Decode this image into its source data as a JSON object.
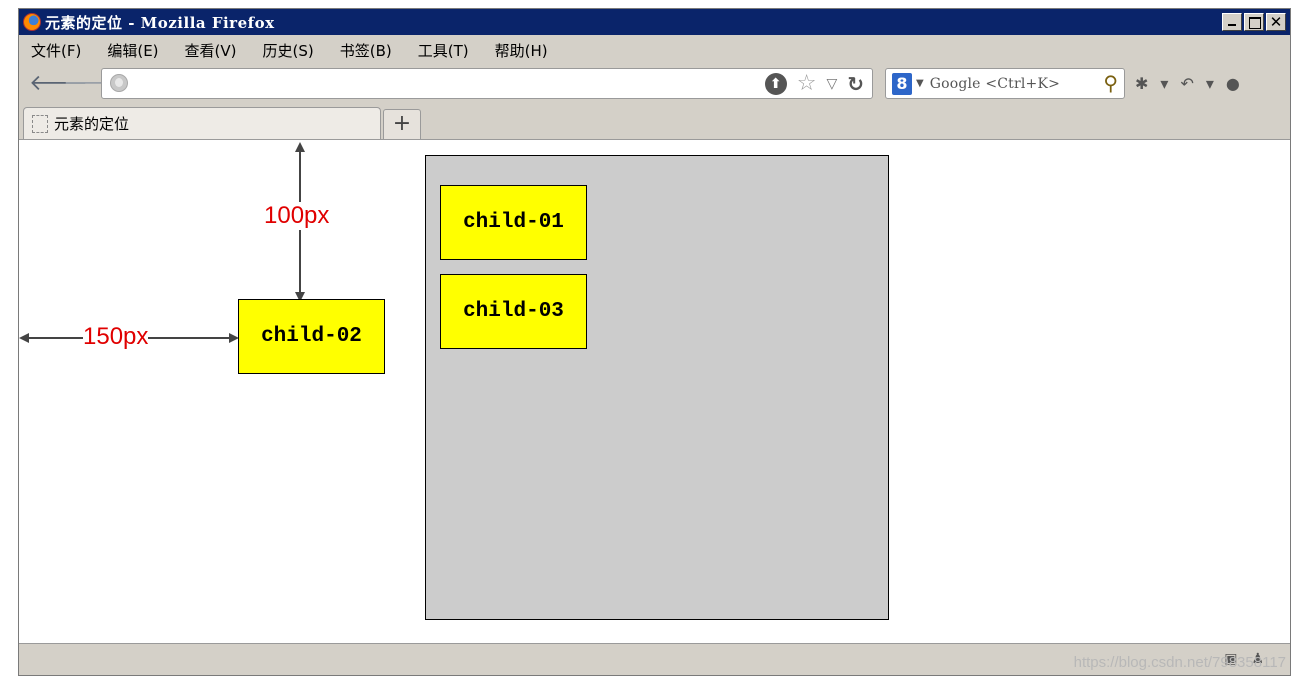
{
  "window": {
    "title": "元素的定位 - Mozilla Firefox"
  },
  "menu": {
    "items": [
      "文件(F)",
      "编辑(E)",
      "查看(V)",
      "历史(S)",
      "书签(B)",
      "工具(T)",
      "帮助(H)"
    ]
  },
  "navbar": {
    "url_value": "",
    "search_engine_glyph": "8",
    "search_placeholder": "Google <Ctrl+K>"
  },
  "tabs": {
    "active_label": "元素的定位",
    "new_tab_label": "+"
  },
  "page": {
    "boxes": {
      "child01": "child-01",
      "child02": "child-02",
      "child03": "child-03"
    },
    "annotations": {
      "top_offset": "100px",
      "left_offset": "150px"
    },
    "colors": {
      "box_fill": "#ffff00",
      "parent_fill": "#cccccc",
      "annotation": "#e00000"
    }
  },
  "statusbar": {
    "watermark": "https://blog.csdn.net/798358117"
  }
}
